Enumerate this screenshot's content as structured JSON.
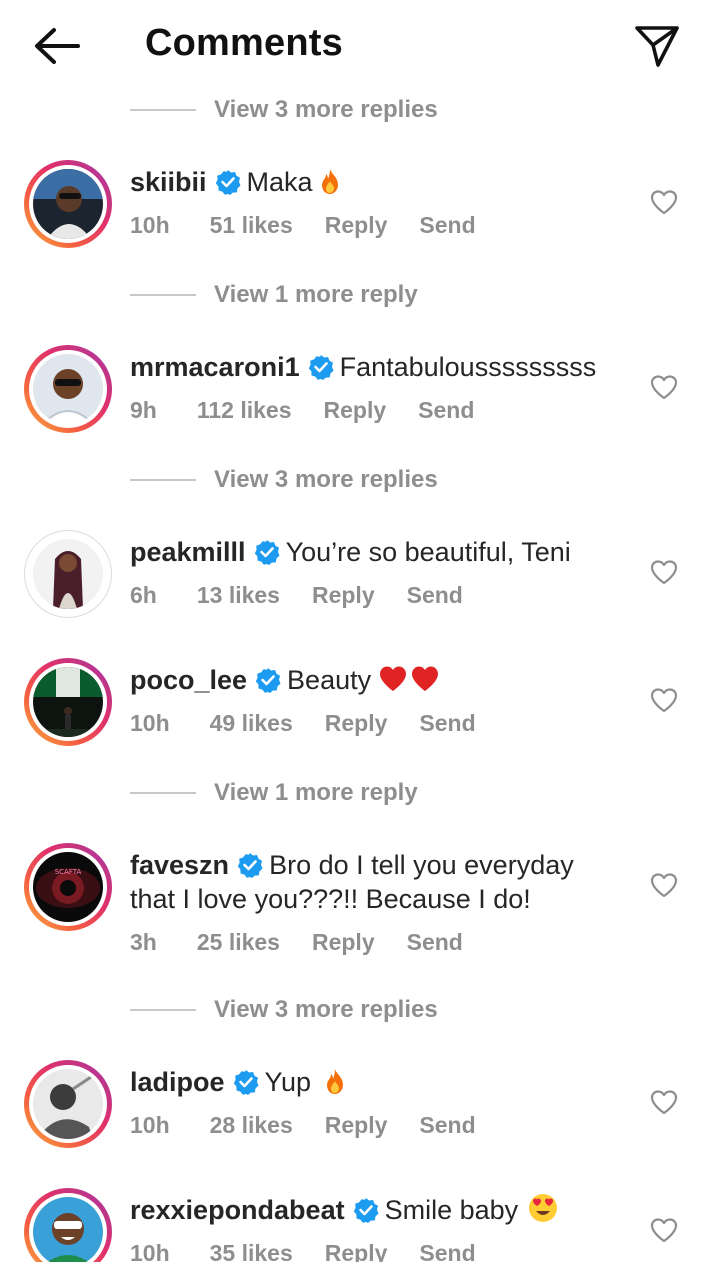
{
  "header": {
    "title": "Comments",
    "back_icon": "arrow-left-icon",
    "send_icon": "paper-plane-icon"
  },
  "colors": {
    "text": "#262626",
    "muted": "#8e8e8e",
    "verified": "#1d9bf0",
    "heart_outline": "#8e8e8e",
    "ring_gradient": [
      "#f9b340",
      "#e1306c",
      "#a235c9"
    ]
  },
  "view_replies": [
    "View 3 more replies",
    "View 1 more reply",
    "View 3 more replies",
    "View 1 more reply",
    "View 3 more replies"
  ],
  "comments": [
    {
      "username": "skiibii",
      "verified": true,
      "text": "Maka",
      "emoji": "fire",
      "time": "10h",
      "likes": "51 likes",
      "reply": "Reply",
      "send": "Send",
      "story_ring": true
    },
    {
      "username": "mrmacaroni1",
      "verified": true,
      "text": "Fantabulousssssssss",
      "emoji": "",
      "time": "9h",
      "likes": "112 likes",
      "reply": "Reply",
      "send": "Send",
      "story_ring": true
    },
    {
      "username": "peakmilll",
      "verified": true,
      "text": "You’re so beautiful, Teni",
      "emoji": "",
      "time": "6h",
      "likes": "13 likes",
      "reply": "Reply",
      "send": "Send",
      "story_ring": false
    },
    {
      "username": "poco_lee",
      "verified": true,
      "text": "Beauty",
      "emoji": "two-red-hearts",
      "time": "10h",
      "likes": "49 likes",
      "reply": "Reply",
      "send": "Send",
      "story_ring": true
    },
    {
      "username": "faveszn",
      "verified": true,
      "text": "Bro do I tell you everyday that I love you???!! Because I do!",
      "emoji": "",
      "time": "3h",
      "likes": "25 likes",
      "reply": "Reply",
      "send": "Send",
      "story_ring": true
    },
    {
      "username": "ladipoe",
      "verified": true,
      "text": "Yup",
      "emoji": "fire",
      "time": "10h",
      "likes": "28 likes",
      "reply": "Reply",
      "send": "Send",
      "story_ring": true
    },
    {
      "username": "rexxiepondabeat",
      "verified": true,
      "text": "Smile baby",
      "emoji": "heart-eyes",
      "time": "10h",
      "likes": "35 likes",
      "reply": "Reply",
      "send": "Send",
      "story_ring": true
    }
  ]
}
